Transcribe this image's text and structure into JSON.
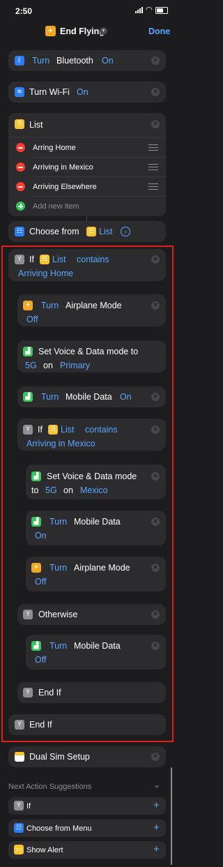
{
  "status_bar": {
    "time": "2:50"
  },
  "header": {
    "title": "End Flying",
    "done_label": "Done"
  },
  "actions": {
    "bluetooth": {
      "verb": "Turn",
      "name": "Bluetooth",
      "value": "On"
    },
    "wifi": {
      "verb": "Turn Wi-Fi",
      "value": "On"
    },
    "list": {
      "title": "List",
      "items": [
        "Arring Home",
        "Arriving in Mexico",
        "Arriving Elsewhere"
      ],
      "add_label": "Add new item"
    },
    "choose": {
      "label": "Choose from",
      "token": "List"
    },
    "if1": {
      "keyword": "If",
      "token": "List",
      "op": "contains",
      "value": "Arriving Home"
    },
    "airplane1": {
      "verb": "Turn",
      "name": "Airplane Mode",
      "value": "Off"
    },
    "voice1": {
      "title": "Set Voice & Data mode to",
      "mode": "5G",
      "on": "on",
      "sim": "Primary"
    },
    "mobile1": {
      "verb": "Turn",
      "name": "Mobile Data",
      "value": "On"
    },
    "if2": {
      "keyword": "If",
      "token": "List",
      "op": "contains",
      "value": "Arriving in Mexico"
    },
    "voice2": {
      "title": "Set Voice & Data mode",
      "to": "to",
      "mode": "5G",
      "on": "on",
      "sim": "Mexico"
    },
    "mobile2": {
      "verb": "Turn",
      "name": "Mobile Data",
      "value": "On"
    },
    "airplane2": {
      "verb": "Turn",
      "name": "Airplane Mode",
      "value": "Off"
    },
    "otherwise": {
      "label": "Otherwise"
    },
    "mobile3": {
      "verb": "Turn",
      "name": "Mobile Data",
      "value": "Off"
    },
    "endif_inner": {
      "label": "End If"
    },
    "endif_outer": {
      "label": "End If"
    },
    "dualsim": {
      "label": "Dual Sim Setup"
    }
  },
  "suggestions": {
    "header": "Next Action Suggestions",
    "items": [
      "If",
      "Choose from Menu",
      "Show Alert"
    ]
  },
  "colors": {
    "accent": "#5aa7ff",
    "highlight_border": "#e0201b"
  }
}
